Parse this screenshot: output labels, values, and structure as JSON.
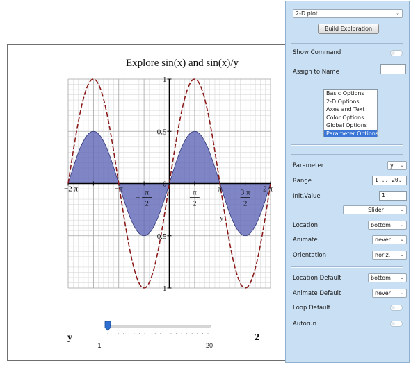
{
  "plot": {
    "title": "Explore sin(x) and sin(x)/y",
    "y_tick_labels": [
      "1",
      "0.5",
      "0",
      "-0.5",
      "-1"
    ],
    "x_axis_label": "y",
    "x_ticks": [
      {
        "id": "neg-2pi",
        "text": "−2 π"
      },
      {
        "id": "neg-pi",
        "text": "−π"
      },
      {
        "id": "neg-pi-half",
        "minus": "−",
        "num": "π",
        "den": "2"
      },
      {
        "id": "pi-half",
        "num": "π",
        "den": "2"
      },
      {
        "id": "pi",
        "text": "π"
      },
      {
        "id": "three-pi-half",
        "num": "3 π",
        "den": "2"
      },
      {
        "id": "two-pi",
        "text": "2 π"
      }
    ],
    "colors": {
      "sin_curve": "#8b1a1a",
      "fill": "#5b63b5",
      "grid": "#d9d9d9"
    }
  },
  "chart_data": {
    "type": "line",
    "title": "Explore sin(x) and sin(x)/y",
    "xlim": [
      -6.2832,
      6.2832
    ],
    "ylim": [
      -1,
      1
    ],
    "grid": true,
    "series": [
      {
        "name": "sin(x)",
        "style": "dashed",
        "function": "sin(x)"
      },
      {
        "name": "sin(x)/y",
        "style": "filled",
        "function": "sin(x)/y",
        "y": 2
      }
    ]
  },
  "slider": {
    "variable": "y",
    "min_label": "1",
    "max_label": "20",
    "value": 1,
    "min": 1,
    "max": 20,
    "current_value_text": "2"
  },
  "panel": {
    "plot_type": "2-D plot",
    "build_button": "Build Exploration",
    "show_command": "Show Command",
    "assign_to_name": "Assign to Name",
    "assign_value": "",
    "options_list": [
      "Basic Options",
      "2-D Options",
      "Axes and Text",
      "Color Options",
      "Global Options",
      "Parameter Options"
    ],
    "selected_option": "Parameter Options",
    "parameter_label": "Parameter",
    "parameter_value": "y",
    "range_label": "Range",
    "range_value": "1 .. 20.",
    "init_value_label": "Init.Value",
    "init_value": "1",
    "control_type": "Slider",
    "location_label": "Location",
    "location_value": "bottom",
    "animate_label": "Animate",
    "animate_value": "never",
    "orientation_label": "Orientation",
    "orientation_value": "horiz.",
    "location_default_label": "Location Default",
    "location_default_value": "bottom",
    "animate_default_label": "Animate Default",
    "animate_default_value": "never",
    "loop_default_label": "Loop Default",
    "autorun_label": "Autorun"
  }
}
